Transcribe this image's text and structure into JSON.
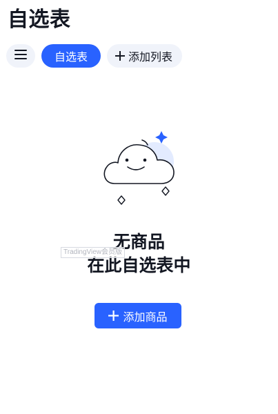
{
  "header": {
    "title": "自选表"
  },
  "tabs": {
    "menu_icon": "hamburger-menu-icon",
    "active_tab_label": "自选表",
    "add_list_label": "添加列表",
    "add_list_icon": "plus-icon"
  },
  "empty_state": {
    "illustration_icon": "smiling-cloud-icon",
    "title": "无商品",
    "subtitle": "在此自选表中",
    "add_button_label": "添加商品",
    "add_button_icon": "plus-icon"
  },
  "watermark": {
    "text": "TradingView会员版"
  },
  "colors": {
    "accent": "#2962ff",
    "pill_background": "#f0f3fa",
    "text_primary": "#131722"
  }
}
